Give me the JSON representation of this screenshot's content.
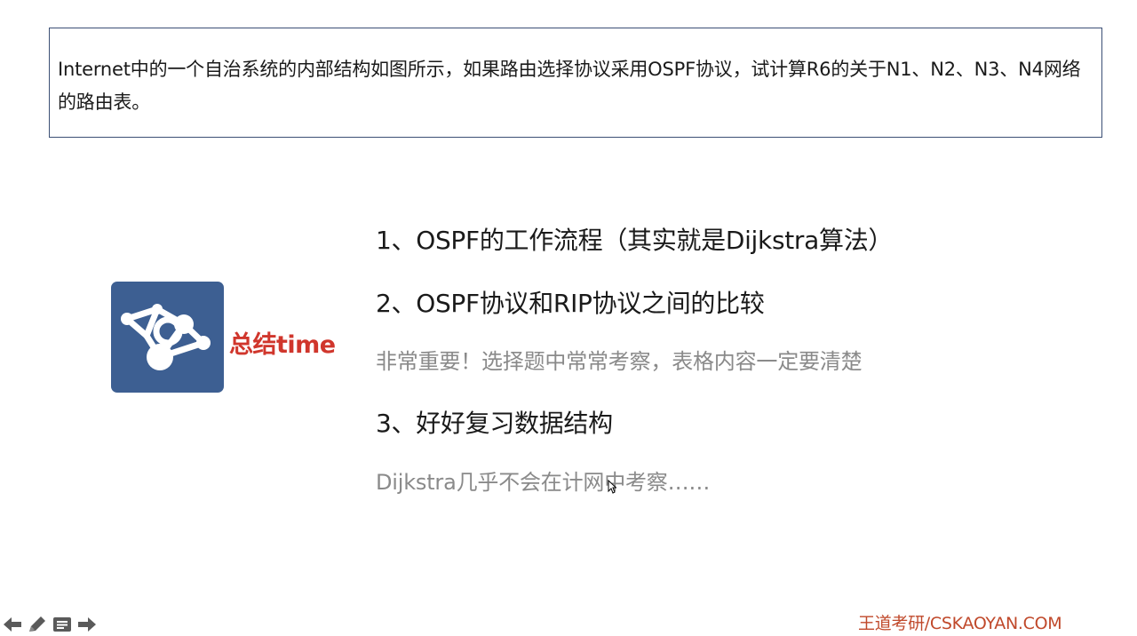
{
  "question": {
    "text": "Internet中的一个自治系统的内部结构如图所示，如果路由选择协议采用OSPF协议，试计算R6的关于N1、N2、N3、N4网络的路由表。"
  },
  "summary": {
    "logo_icon": "network-graph-icon",
    "title": "总结time",
    "title_color": "#d0362c",
    "logo_color": "#3d5f92"
  },
  "points": [
    {
      "text": "1、OSPF的工作流程（其实就是Dijkstra算法）"
    },
    {
      "text": "2、OSPF协议和RIP协议之间的比较"
    },
    {
      "text": "3、好好复习数据结构"
    }
  ],
  "notes": [
    {
      "text": "非常重要！选择题中常常考察，表格内容一定要清楚"
    },
    {
      "text": "Dijkstra几乎不会在计网中考察……"
    }
  ],
  "nav": {
    "icons": [
      "arrow-left-icon",
      "pen-icon",
      "menu-icon",
      "arrow-right-icon"
    ]
  },
  "watermark": {
    "text": "王道考研/CSKAOYAN.COM",
    "color": "#c0492b"
  }
}
